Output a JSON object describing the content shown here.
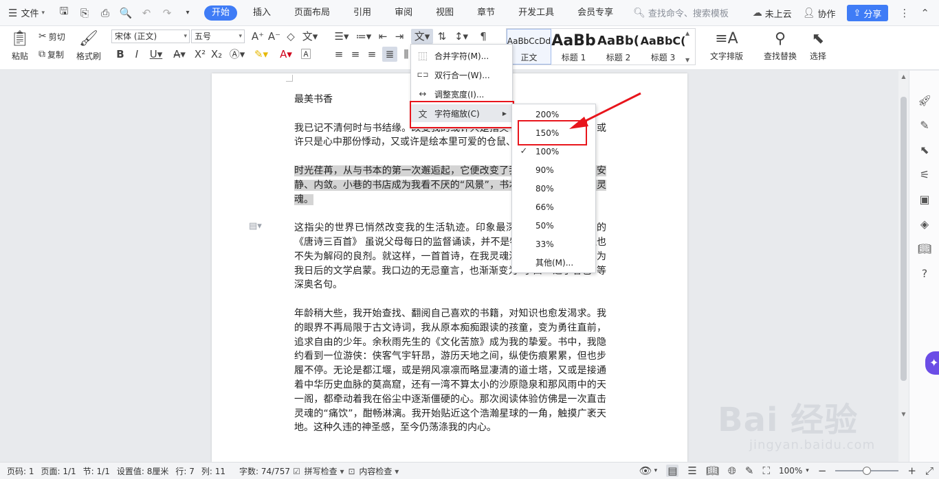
{
  "menubar": {
    "file_label": "文件",
    "tabs": [
      "开始",
      "插入",
      "页面布局",
      "引用",
      "审阅",
      "视图",
      "章节",
      "开发工具",
      "会员专享"
    ],
    "active_tab": "开始",
    "search_placeholder": "查找命令、搜索模板",
    "cloud_label": "未上云",
    "collab_label": "协作",
    "share_label": "分享"
  },
  "ribbon": {
    "paste": "粘贴",
    "cut": "剪切",
    "copy": "复制",
    "format_painter": "格式刷",
    "font_name": "宋体 (正文)",
    "font_size": "五号",
    "styles": [
      {
        "preview": "AaBbCcDd",
        "name": "正文"
      },
      {
        "preview": "AaBb",
        "name": "标题 1"
      },
      {
        "preview": "AaBb(",
        "name": "标题 2"
      },
      {
        "preview": "AaBbC(",
        "name": "标题 3"
      }
    ],
    "text_layout": "文字排版",
    "find_replace": "查找替换",
    "select": "选择"
  },
  "document": {
    "title": "最美书香",
    "paragraphs": [
      "我已记不清何时与书结缘。改变我的或许只是指尖书页的那一抹墨香，或许只是心中那份悸动，又或许是绘本里可爱的仓鼠、小兔……",
      "时光荏苒，从与书本的第一次邂逅起，它便改变了我的生活，让我变得安静、内敛。小巷的书店成为我看不厌的“风景”，书本似常安抚我躁动的灵魂。",
      "这指尖的世界已悄然改变我的生活轨迹。印象最深的，便是朗朗上口的《唐诗三百首》 虽说父母每日的监督诵读，并不是特别有趣的回忆，但也不失为解闷的良剂。就这样，一首首诗，在我灵魂深处播种、发芽，成为我日后的文学启蒙。我口边的无忌童言，也渐渐变为“子曰”“之乎者也”等深奥名句。",
      "年龄稍大些，我开始查找、翻阅自己喜欢的书籍，对知识也愈发渴求。我的眼界不再局限于古文诗词，我从原本痴痴跟读的孩童，变为勇往直前，追求自由的少年。余秋雨先生的《文化苦旅》成为我的挚爱。书中，我隐约看到一位游侠：侠客气宇轩昂，游历天地之间，纵使伤痕累累，但也步履不停。无论是都江堰，或是朔风凛凛而略显凄清的道士塔，又或是接通着中华历史血脉的莫高窟，还有一湾不算太小的沙原隐泉和那风雨中的天一阁，都牵动着我在俗尘中逐渐僵硬的心。那次阅读体验仿佛是一次直击灵魂的“痛饮”，酣畅淋漓。我开始贴近这个浩瀚星球的一角，触摸广袤天地。这种久违的神圣感，至今仍荡涤我的内心。"
    ]
  },
  "menu1": {
    "items": [
      {
        "label": "合并字符(M)...",
        "icon": "merge-chars-icon",
        "glyph": "⿲"
      },
      {
        "label": "双行合一(W)...",
        "icon": "two-lines-icon",
        "glyph": "⊏⊐"
      },
      {
        "label": "调整宽度(I)...",
        "icon": "adjust-width-icon",
        "glyph": "↔"
      },
      {
        "label": "字符缩放(C)",
        "icon": "char-scale-icon",
        "glyph": "文"
      }
    ]
  },
  "menu2": {
    "items": [
      "200%",
      "150%",
      "100%",
      "90%",
      "80%",
      "66%",
      "50%",
      "33%",
      "其他(M)..."
    ],
    "checked": "100%"
  },
  "status": {
    "page_num": "页码: 1",
    "pages": "页面: 1/1",
    "section": "节: 1/1",
    "setting": "设置值: 8厘米",
    "row": "行: 7",
    "col": "列: 11",
    "word_count": "字数: 74/757",
    "spell_check": "拼写检查",
    "content_check": "内容检查",
    "zoom": "100%"
  },
  "watermark": {
    "main": "Bai  经验",
    "sub": "jingyan.baidu.com"
  }
}
